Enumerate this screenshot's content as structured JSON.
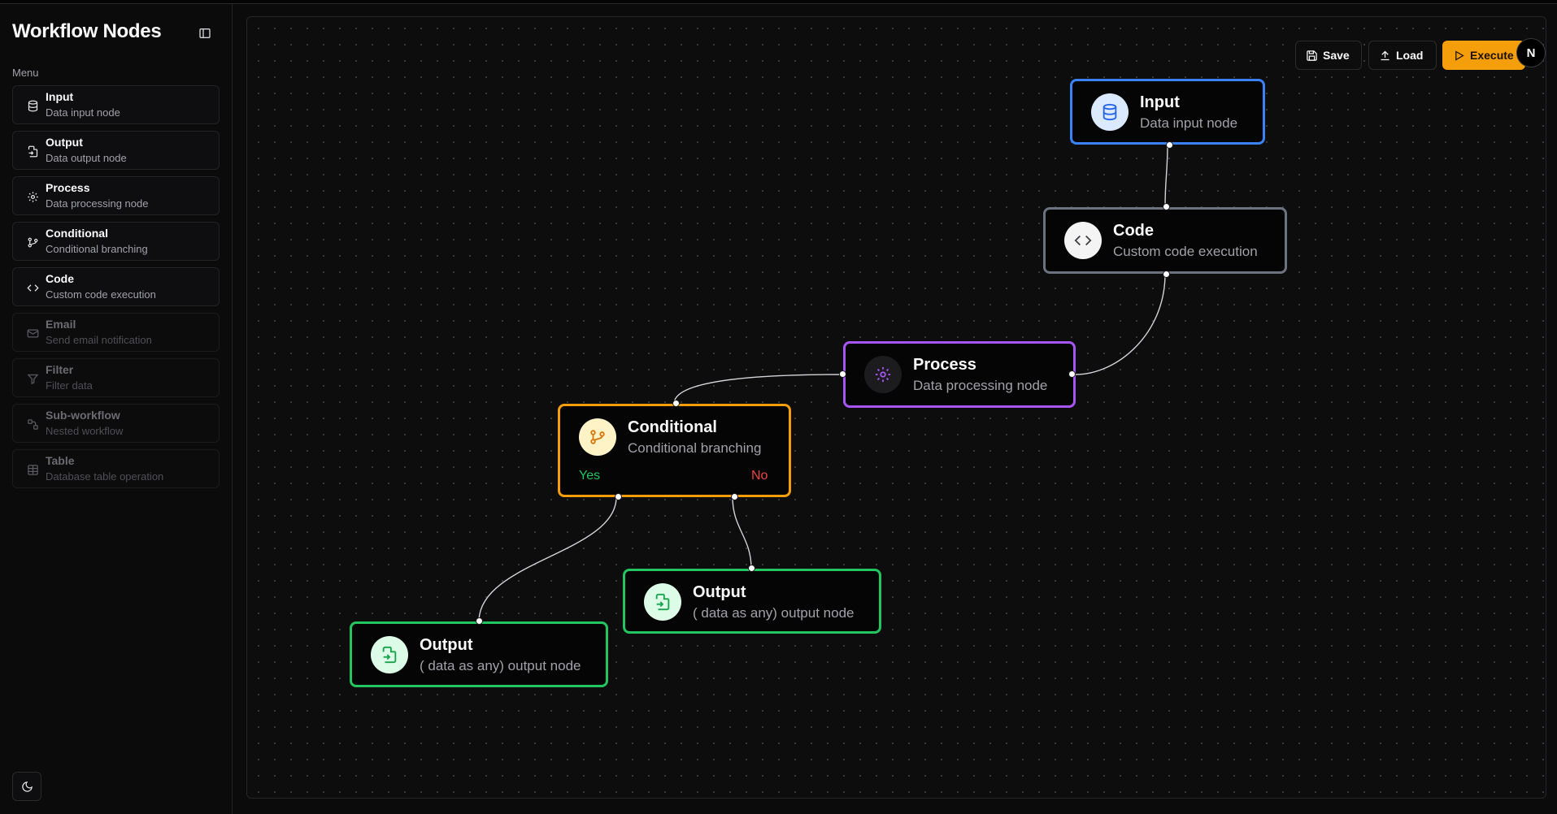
{
  "app": {
    "title": "Workflow Nodes"
  },
  "sidebar": {
    "menu_label": "Menu",
    "items": [
      {
        "title": "Input",
        "subtitle": "Data input node",
        "icon": "database-icon",
        "enabled": true
      },
      {
        "title": "Output",
        "subtitle": "Data output node",
        "icon": "file-output-icon",
        "enabled": true
      },
      {
        "title": "Process",
        "subtitle": "Data processing node",
        "icon": "gear-icon",
        "enabled": true
      },
      {
        "title": "Conditional",
        "subtitle": "Conditional branching",
        "icon": "git-branch-icon",
        "enabled": true
      },
      {
        "title": "Code",
        "subtitle": "Custom code execution",
        "icon": "code-icon",
        "enabled": true
      },
      {
        "title": "Email",
        "subtitle": "Send email notification",
        "icon": "mail-icon",
        "enabled": false
      },
      {
        "title": "Filter",
        "subtitle": "Filter data",
        "icon": "filter-icon",
        "enabled": false
      },
      {
        "title": "Sub-workflow",
        "subtitle": "Nested workflow",
        "icon": "workflow-icon",
        "enabled": false
      },
      {
        "title": "Table",
        "subtitle": "Database table operation",
        "icon": "table-icon",
        "enabled": false
      }
    ]
  },
  "toolbar": {
    "save_label": "Save",
    "load_label": "Load",
    "execute_label": "Execute"
  },
  "avatar": {
    "initial": "N"
  },
  "nodes": {
    "input": {
      "title": "Input",
      "subtitle": "Data input node",
      "color": "#3b82f6"
    },
    "code": {
      "title": "Code",
      "subtitle": "Custom code execution",
      "color": "#6b7280"
    },
    "process": {
      "title": "Process",
      "subtitle": "Data processing node",
      "color": "#a855f7"
    },
    "conditional": {
      "title": "Conditional",
      "subtitle": "Conditional branching",
      "yes_label": "Yes",
      "no_label": "No",
      "color": "#f59e0b"
    },
    "output_no": {
      "title": "Output",
      "subtitle": "( data as any) output node",
      "color": "#22c55e"
    },
    "output_yes": {
      "title": "Output",
      "subtitle": "( data as any) output node",
      "color": "#22c55e"
    }
  },
  "colors": {
    "execute": "#f59e0b",
    "yes": "#22c55e",
    "no": "#ef4444"
  }
}
